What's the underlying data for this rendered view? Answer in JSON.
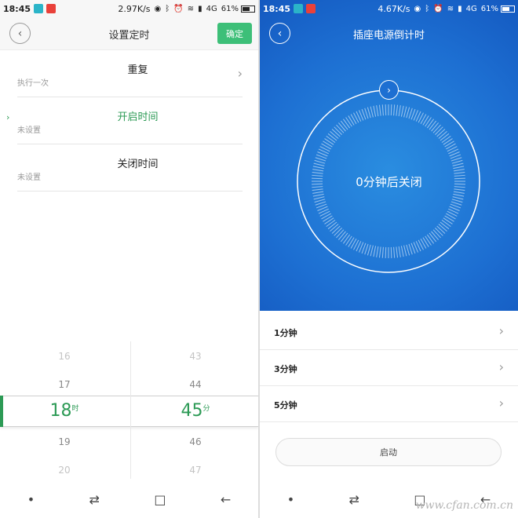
{
  "left": {
    "status": {
      "time": "18:45",
      "speed": "2.97K/s",
      "network": "4G",
      "battery": "61%",
      "battery_level": 0.61
    },
    "header": {
      "back_icon": "chevron-left-icon",
      "title": "设置定时",
      "confirm_label": "确定"
    },
    "rows": [
      {
        "title": "重复",
        "subtitle": "执行一次",
        "active": false
      },
      {
        "title": "开启时间",
        "subtitle": "未设置",
        "active": true
      },
      {
        "title": "关闭时间",
        "subtitle": "未设置",
        "active": false
      }
    ],
    "picker": {
      "hours": {
        "above2": "16",
        "above1": "17",
        "selected": "18",
        "unit": "时",
        "below1": "19",
        "below2": "20"
      },
      "minutes": {
        "above2": "43",
        "above1": "44",
        "selected": "45",
        "unit": "分",
        "below1": "46",
        "below2": "47"
      }
    }
  },
  "right": {
    "status": {
      "time": "18:45",
      "speed": "4.67K/s",
      "network": "4G",
      "battery": "61%",
      "battery_level": 0.61
    },
    "header": {
      "back_icon": "chevron-left-icon",
      "title": "插座电源倒计时"
    },
    "dial": {
      "text": "0分钟后关闭",
      "handle_icon": "chevron-right-icon"
    },
    "options": [
      {
        "label": "1分钟"
      },
      {
        "label": "3分钟"
      },
      {
        "label": "5分钟"
      }
    ],
    "start_label": "启动",
    "watermark": "www.cfan.com.cn"
  },
  "colors": {
    "accent_green": "#2c9a55",
    "confirm_green": "#3dbf78",
    "blue": "#1d6fd2"
  }
}
